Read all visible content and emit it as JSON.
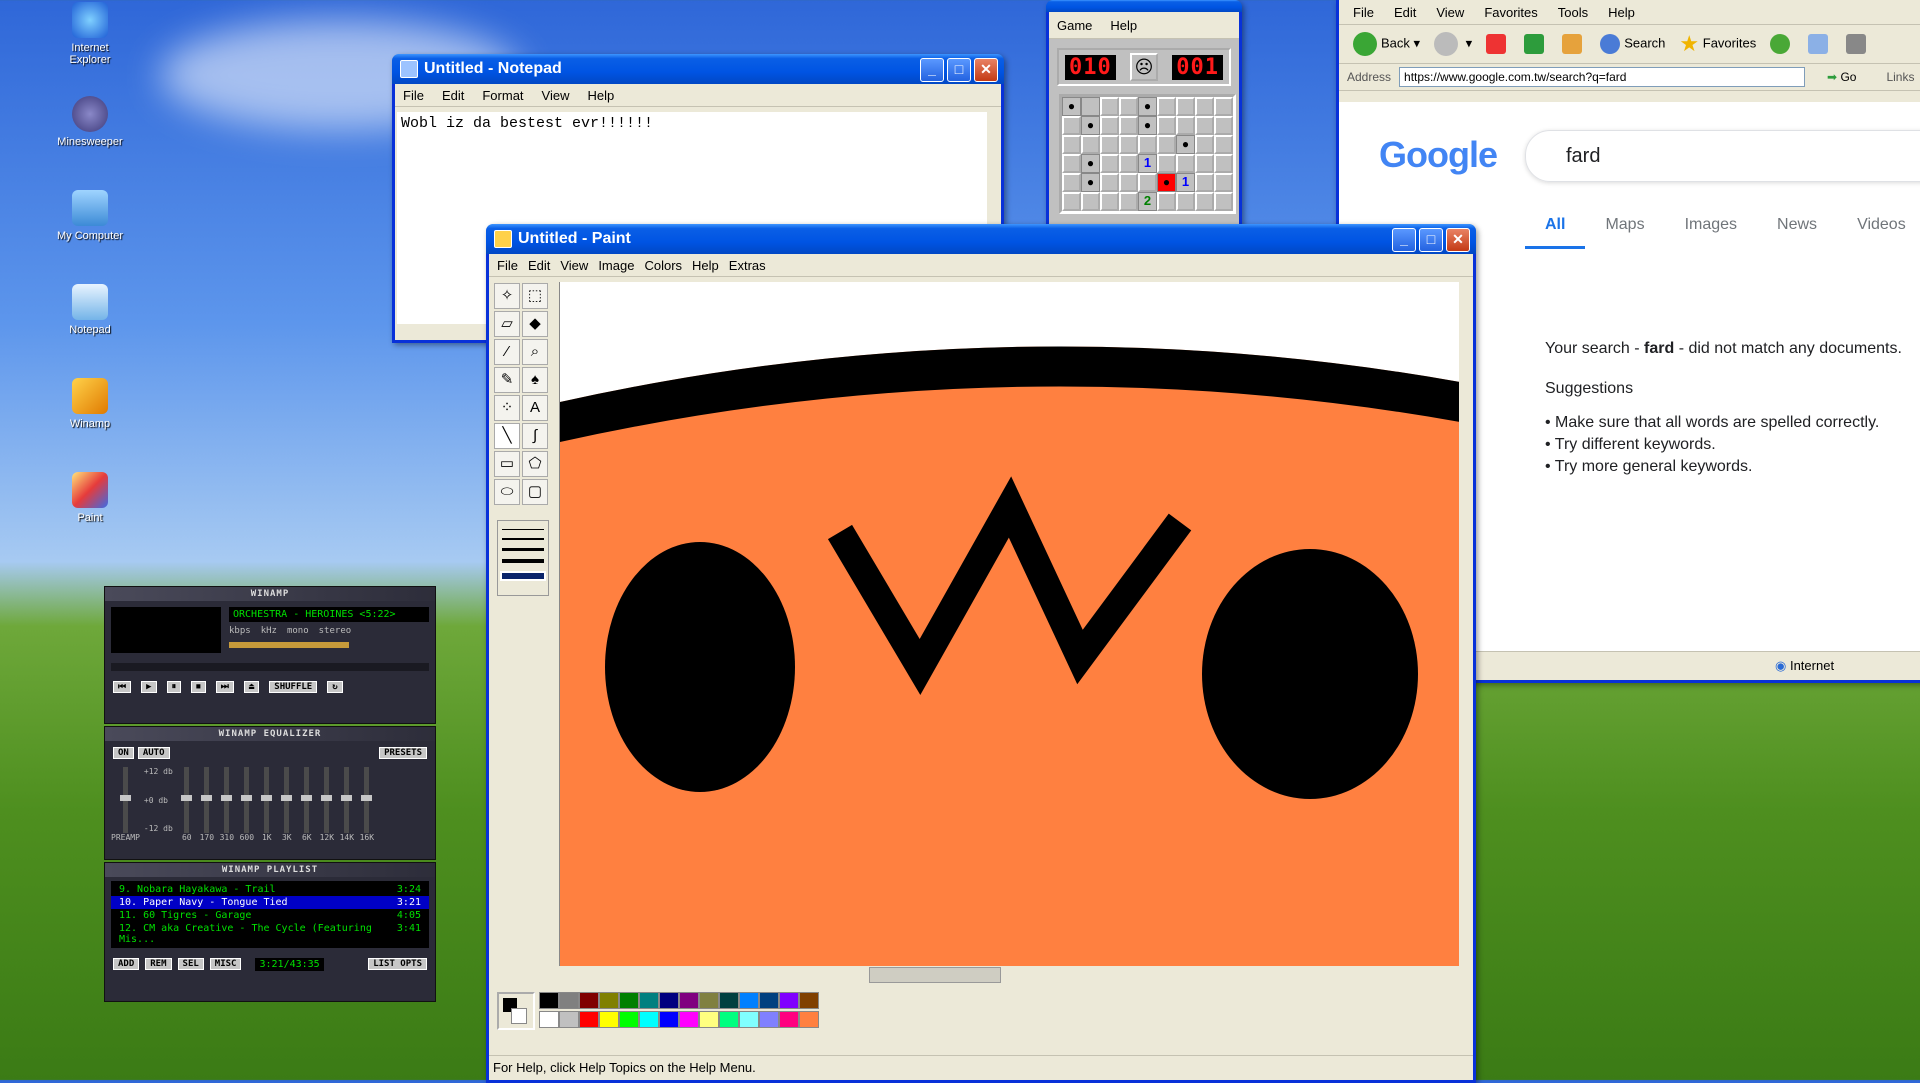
{
  "desktop": {
    "icons": [
      {
        "label": "Internet Explorer"
      },
      {
        "label": "Minesweeper"
      },
      {
        "label": "My Computer"
      },
      {
        "label": "Notepad"
      },
      {
        "label": "Winamp"
      },
      {
        "label": "Paint"
      }
    ]
  },
  "notepad": {
    "title": "Untitled - Notepad",
    "menu": [
      "File",
      "Edit",
      "Format",
      "View",
      "Help"
    ],
    "text": "Wobl iz da bestest evr!!!!!!"
  },
  "minesweeper": {
    "menu": [
      "Game",
      "Help"
    ],
    "mines_left": "010",
    "timer": "001",
    "numbers": [
      "1",
      "1",
      "2"
    ]
  },
  "browser": {
    "menu": [
      "File",
      "Edit",
      "View",
      "Favorites",
      "Tools",
      "Help"
    ],
    "toolbar": {
      "back": "Back",
      "search": "Search",
      "favorites": "Favorites"
    },
    "address_label": "Address",
    "url": "https://www.google.com.tw/search?q=fard",
    "go": "Go",
    "links": "Links",
    "google": {
      "logo": "Google",
      "query": "fard",
      "tabs": [
        "All",
        "Maps",
        "Images",
        "News",
        "Videos"
      ],
      "result_prefix": "Your search - ",
      "result_term": "fard",
      "result_suffix": " - did not match any documents.",
      "suggestions_heading": "Suggestions",
      "suggestions": [
        "Make sure that all words are spelled correctly.",
        "Try different keywords.",
        "Try more general keywords."
      ]
    },
    "status_zone": "Internet"
  },
  "paint": {
    "title": "Untitled - Paint",
    "menu": [
      "File",
      "Edit",
      "View",
      "Image",
      "Colors",
      "Help",
      "Extras"
    ],
    "status": "For Help, click Help Topics on the Help Menu.",
    "colors": {
      "canvas": "#ff8040",
      "ink": "#000000"
    },
    "palette": [
      "#000000",
      "#808080",
      "#800000",
      "#808000",
      "#008000",
      "#008080",
      "#000080",
      "#800080",
      "#808040",
      "#004040",
      "#0080ff",
      "#004080",
      "#8000ff",
      "#804000",
      "#ffffff",
      "#c0c0c0",
      "#ff0000",
      "#ffff00",
      "#00ff00",
      "#00ffff",
      "#0000ff",
      "#ff00ff",
      "#ffff80",
      "#00ff80",
      "#80ffff",
      "#8080ff",
      "#ff0080",
      "#ff8040"
    ]
  },
  "winamp": {
    "main_title": "WINAMP",
    "song": "ORCHESTRA - HEROINES <5:22>",
    "kbps": "kbps",
    "khz": "kHz",
    "mono": "mono",
    "stereo": "stereo",
    "shuffle": "SHUFFLE",
    "eq_title": "WINAMP EQUALIZER",
    "eq_on": "ON",
    "eq_auto": "AUTO",
    "eq_presets": "PRESETS",
    "eq_db": [
      "+12 db",
      "+0 db",
      "-12 db"
    ],
    "eq_preamp": "PREAMP",
    "eq_bands": [
      "60",
      "170",
      "310",
      "600",
      "1K",
      "3K",
      "6K",
      "12K",
      "14K",
      "16K"
    ],
    "pl_title": "WINAMP PLAYLIST",
    "playlist": [
      {
        "name": "9. Nobara Hayakawa - Trail",
        "time": "3:24"
      },
      {
        "name": "10. Paper Navy - Tongue Tied",
        "time": "3:21"
      },
      {
        "name": "11. 60 Tigres - Garage",
        "time": "4:05"
      },
      {
        "name": "12. CM aka Creative - The Cycle (Featuring Mis...",
        "time": "3:41"
      }
    ],
    "pl_buttons": [
      "ADD",
      "REM",
      "SEL",
      "MISC"
    ],
    "pl_time": "3:21/43:35",
    "pl_list_opts": "LIST OPTS"
  }
}
